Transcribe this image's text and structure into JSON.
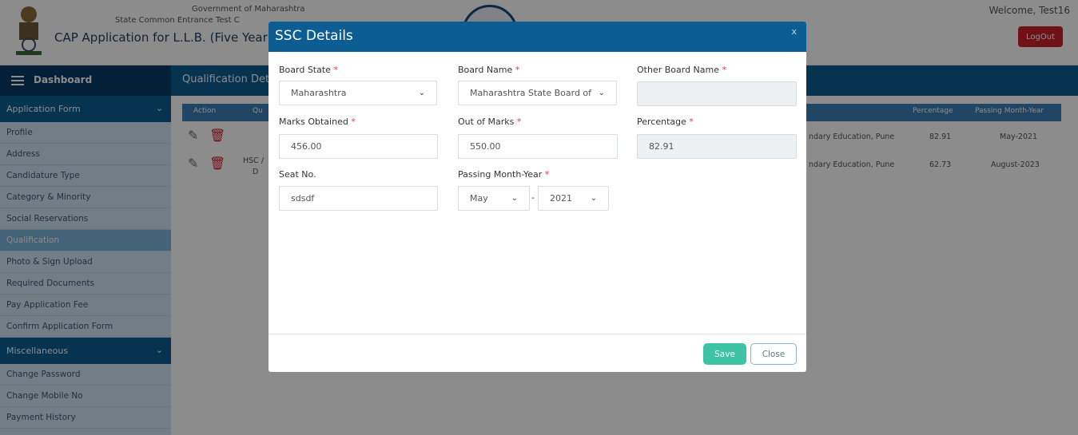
{
  "header": {
    "gov_text": "Government of Maharashtra",
    "cet_text": "State Common Entrance Test C",
    "cap_title": "CAP Application for L.L.B. (Five Year Integ",
    "welcome": "Welcome, Test16",
    "logout_label": "LogOut"
  },
  "nav": {
    "dashboard_label": "Dashboard",
    "section_title": "Qualification Det"
  },
  "sidebar": {
    "application_form_label": "Application Form",
    "items": [
      "Profile",
      "Address",
      "Candidature Type",
      "Category & Minority",
      "Social Reservations",
      "Qualification",
      "Photo & Sign Upload",
      "Required Documents",
      "Pay Application Fee",
      "Confirm Application Form"
    ],
    "active_item": "Qualification",
    "misc_label": "Miscellaneous",
    "misc_items": [
      "Change Password",
      "Change Mobile No",
      "Payment History"
    ]
  },
  "table": {
    "headers": {
      "action": "Action",
      "qual": "Qu",
      "percentage": "Percentage",
      "passing": "Passing Month-Year"
    },
    "rows": [
      {
        "qual": "",
        "qual2": "",
        "board": "ndary Education, Pune",
        "percentage": "82.91",
        "passing": "May-2021"
      },
      {
        "qual": "HSC /",
        "qual2": "D",
        "board": "ndary Education, Pune",
        "percentage": "62.73",
        "passing": "August-2023"
      }
    ]
  },
  "modal": {
    "title": "SSC Details",
    "close_x": "x",
    "fields": {
      "board_state": {
        "label": "Board State",
        "value": "Maharashtra"
      },
      "board_name": {
        "label": "Board Name",
        "value": "Maharashtra State Board of"
      },
      "other_board_name": {
        "label": "Other Board Name",
        "value": ""
      },
      "marks_obtained": {
        "label": "Marks Obtained",
        "value": "456.00"
      },
      "out_of_marks": {
        "label": "Out of Marks",
        "value": "550.00"
      },
      "percentage": {
        "label": "Percentage",
        "value": "82.91"
      },
      "seat_no": {
        "label": "Seat No.",
        "value": "sdsdf"
      },
      "passing_month_year": {
        "label": "Passing Month-Year",
        "month": "May",
        "year": "2021"
      }
    },
    "required_mark": "*",
    "separator": "-",
    "save_label": "Save",
    "close_label": "Close"
  },
  "colors": {
    "primary": "#0b5d92",
    "save": "#3ec4a4",
    "logout": "#cc1f2b",
    "required": "#e04040"
  }
}
